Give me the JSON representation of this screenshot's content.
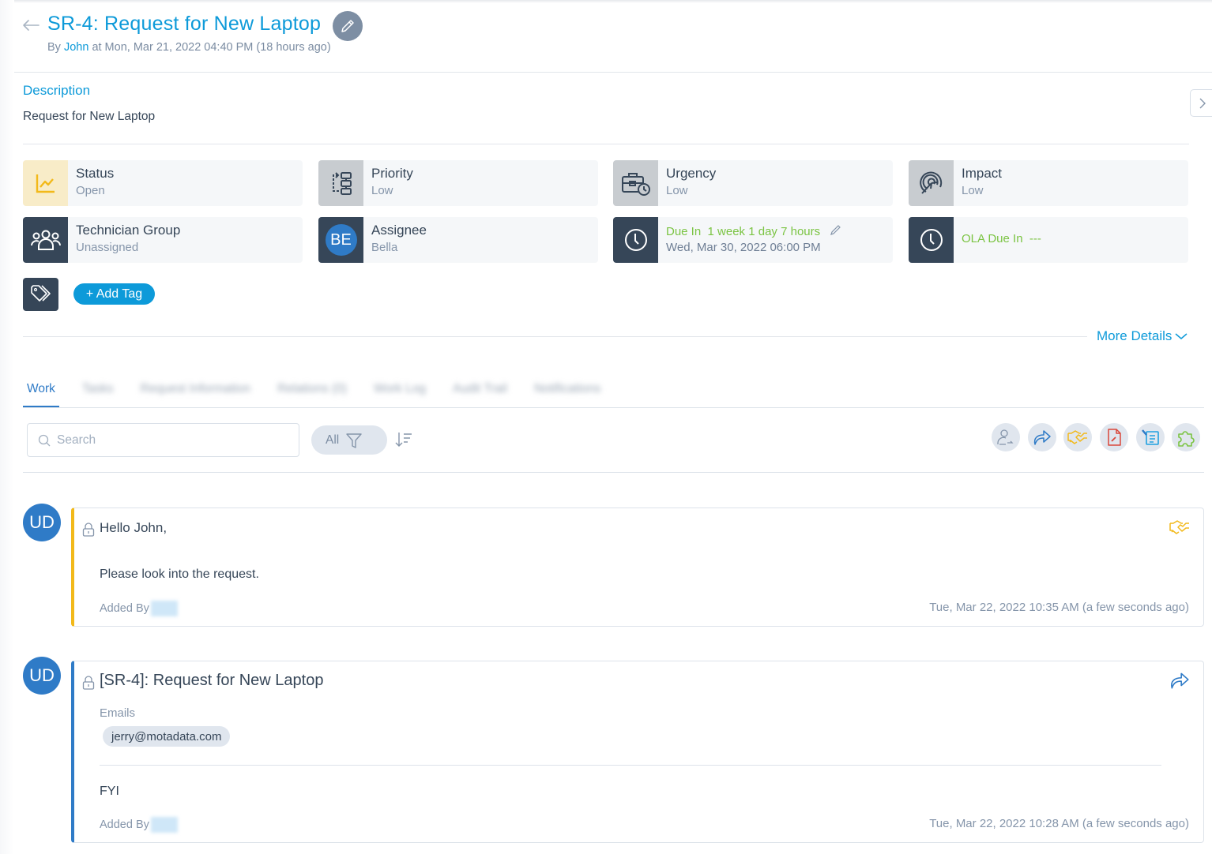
{
  "header": {
    "title": "SR-4: Request for New Laptop",
    "by_prefix": "By",
    "author": "John",
    "created_suffix": "at Mon, Mar 21, 2022 04:40 PM (18 hours ago)"
  },
  "description": {
    "label": "Description",
    "text": "Request for New Laptop"
  },
  "properties": [
    {
      "label": "Status",
      "value": "Open",
      "icon": "trend-chart-icon"
    },
    {
      "label": "Priority",
      "value": "Low",
      "icon": "priority-flow-icon"
    },
    {
      "label": "Urgency",
      "value": "Low",
      "icon": "briefcase-clock-icon"
    },
    {
      "label": "Impact",
      "value": "Low",
      "icon": "target-cursor-icon"
    },
    {
      "label": "Technician Group",
      "value": "Unassigned",
      "icon": "group-icon"
    },
    {
      "label": "Assignee",
      "value": "Bella",
      "avatar_initials": "BE"
    },
    {
      "label": "Due In  1 week 1 day 7 hours",
      "value": "Wed, Mar 30, 2022 06:00 PM",
      "icon": "clock-icon"
    },
    {
      "label": "OLA Due In  ---",
      "value": "",
      "icon": "clock-icon"
    }
  ],
  "tags": {
    "add_label": "+ Add Tag"
  },
  "more_details_label": "More Details",
  "tabs": [
    {
      "label": "Work",
      "active": true
    },
    {
      "label": "Tasks",
      "blurred": true
    },
    {
      "label": "Request Information",
      "blurred": true
    },
    {
      "label": "Relations (0)",
      "blurred": true
    },
    {
      "label": "Work Log",
      "blurred": true
    },
    {
      "label": "Audit Trail",
      "blurred": true
    },
    {
      "label": "Notifications",
      "blurred": true
    }
  ],
  "toolbar": {
    "search_placeholder": "Search",
    "filter_label": "All",
    "actions": [
      {
        "name": "assign-user",
        "color": "#8595aa"
      },
      {
        "name": "forward",
        "color": "#2f7bc7"
      },
      {
        "name": "collaborate",
        "color": "#f2b91a"
      },
      {
        "name": "pdf-export",
        "color": "#d9473a"
      },
      {
        "name": "add-note",
        "color": "#1fa0e0"
      },
      {
        "name": "integration",
        "color": "#7bc443"
      }
    ]
  },
  "feed": [
    {
      "type": "collaboration",
      "avatar_initials": "UD",
      "title": "Hello John,",
      "body": "Please look into the request.",
      "added_by_label": "Added By",
      "timestamp": "Tue, Mar 22, 2022 10:35 AM (a few seconds ago)",
      "accent_color": "#f2b91a"
    },
    {
      "type": "forward",
      "avatar_initials": "UD",
      "title": "[SR-4]: Request for New Laptop",
      "emails_label": "Emails",
      "emails": [
        "jerry@motadata.com"
      ],
      "body": "FYI",
      "added_by_label": "Added By",
      "timestamp": "Tue, Mar 22, 2022 10:28 AM (a few seconds ago)",
      "accent_color": "#2f7bc7"
    }
  ]
}
